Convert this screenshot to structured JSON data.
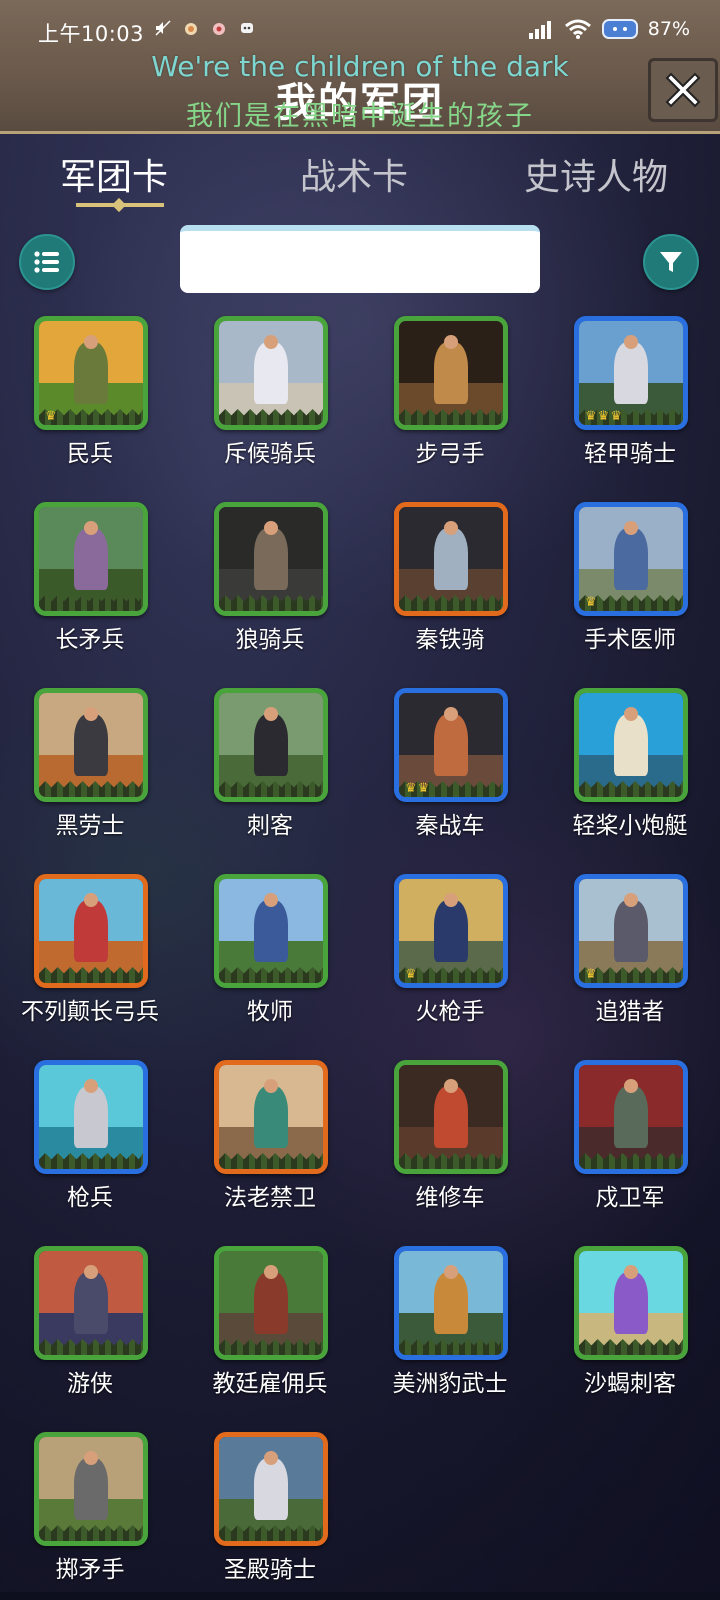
{
  "status_bar": {
    "time": "上午10:03",
    "battery": "87%"
  },
  "header": {
    "title": "我的军团",
    "lyric_en": "We're the children of the dark",
    "lyric_zh": "我们是在黑暗中诞生的孩子"
  },
  "tabs": [
    {
      "label": "军团卡",
      "active": true
    },
    {
      "label": "战术卡",
      "active": false
    },
    {
      "label": "史诗人物",
      "active": false
    }
  ],
  "search": {
    "value": "",
    "placeholder": ""
  },
  "icons": {
    "list": "list-icon",
    "filter": "filter-icon",
    "close": "close-icon"
  },
  "colors": {
    "rarity_green": "#49a53b",
    "rarity_blue": "#2a6fe0",
    "rarity_orange": "#e26a1c",
    "accent_teal": "#1f7a78"
  },
  "cards": [
    {
      "name": "民兵",
      "rarity": "green",
      "sky": "#e2a63a",
      "ground": "#5a8a2a",
      "fig": "#6a7a3a",
      "crowns": 1
    },
    {
      "name": "斥候骑兵",
      "rarity": "green",
      "sky": "#a9b8c8",
      "ground": "#c9c3b6",
      "fig": "#e8e8f0",
      "crowns": 0
    },
    {
      "name": "步弓手",
      "rarity": "green",
      "sky": "#2a2018",
      "ground": "#6a4a2a",
      "fig": "#c08a4a",
      "crowns": 0
    },
    {
      "name": "轻甲骑士",
      "rarity": "blue",
      "sky": "#6aa0d0",
      "ground": "#3a5a3a",
      "fig": "#d8d8e0",
      "crowns": 3
    },
    {
      "name": "长矛兵",
      "rarity": "green",
      "sky": "#5a8a5a",
      "ground": "#3a5a2a",
      "fig": "#8a6a9a",
      "crowns": 0
    },
    {
      "name": "狼骑兵",
      "rarity": "green",
      "sky": "#2a2a28",
      "ground": "#3a3a38",
      "fig": "#7a6a5a",
      "crowns": 0
    },
    {
      "name": "秦铁骑",
      "rarity": "orange",
      "sky": "#2a2a30",
      "ground": "#5a4030",
      "fig": "#a0b0c0",
      "crowns": 0
    },
    {
      "name": "手术医师",
      "rarity": "blue",
      "sky": "#9ab0c8",
      "ground": "#7a8a6a",
      "fig": "#4a6aa0",
      "crowns": 1
    },
    {
      "name": "黑劳士",
      "rarity": "green",
      "sky": "#c8a880",
      "ground": "#b86a30",
      "fig": "#3a3a40",
      "crowns": 0
    },
    {
      "name": "刺客",
      "rarity": "green",
      "sky": "#7a9a70",
      "ground": "#4a6a3a",
      "fig": "#2a2a30",
      "crowns": 0
    },
    {
      "name": "秦战车",
      "rarity": "blue",
      "sky": "#2a2a30",
      "ground": "#6a4a3a",
      "fig": "#c06a40",
      "crowns": 2
    },
    {
      "name": "轻桨小炮艇",
      "rarity": "green",
      "sky": "#2aa0d8",
      "ground": "#2a6a8a",
      "fig": "#e8e0c8",
      "crowns": 0
    },
    {
      "name": "不列颠长弓兵",
      "rarity": "orange",
      "sky": "#6ab8d8",
      "ground": "#c06a30",
      "fig": "#c03a3a",
      "crowns": 0
    },
    {
      "name": "牧师",
      "rarity": "green",
      "sky": "#8ab8e0",
      "ground": "#4a7a3a",
      "fig": "#3a5a9a",
      "crowns": 0
    },
    {
      "name": "火枪手",
      "rarity": "blue",
      "sky": "#d0b060",
      "ground": "#5a6a4a",
      "fig": "#2a3a6a",
      "crowns": 1
    },
    {
      "name": "追猎者",
      "rarity": "blue",
      "sky": "#a8c0d0",
      "ground": "#8a7a5a",
      "fig": "#5a5a6a",
      "crowns": 1
    },
    {
      "name": "枪兵",
      "rarity": "blue",
      "sky": "#5ac8d8",
      "ground": "#2a8aa0",
      "fig": "#c8c8d0",
      "crowns": 0
    },
    {
      "name": "法老禁卫",
      "rarity": "orange",
      "sky": "#d8b890",
      "ground": "#8a6a4a",
      "fig": "#3a8a7a",
      "crowns": 0
    },
    {
      "name": "维修车",
      "rarity": "green",
      "sky": "#3a2a22",
      "ground": "#5a3a2a",
      "fig": "#c04a30",
      "crowns": 0
    },
    {
      "name": "戍卫军",
      "rarity": "blue",
      "sky": "#8a2a2a",
      "ground": "#4a2a2a",
      "fig": "#5a6a5a",
      "crowns": 0
    },
    {
      "name": "游侠",
      "rarity": "green",
      "sky": "#c05a40",
      "ground": "#3a3a60",
      "fig": "#4a4a6a",
      "crowns": 0
    },
    {
      "name": "教廷雇佣兵",
      "rarity": "green",
      "sky": "#4a7a3a",
      "ground": "#5a4a3a",
      "fig": "#8a3a2a",
      "crowns": 0
    },
    {
      "name": "美洲豹武士",
      "rarity": "blue",
      "sky": "#7ab8d8",
      "ground": "#3a5a3a",
      "fig": "#c88a3a",
      "crowns": 0
    },
    {
      "name": "沙蝎刺客",
      "rarity": "green",
      "sky": "#6ad8e0",
      "ground": "#c8b880",
      "fig": "#8a5ac8",
      "crowns": 0
    },
    {
      "name": "掷矛手",
      "rarity": "green",
      "sky": "#b8a078",
      "ground": "#5a7a3a",
      "fig": "#6a6a6a",
      "crowns": 0
    },
    {
      "name": "圣殿骑士",
      "rarity": "orange",
      "sky": "#5a7a9a",
      "ground": "#4a6a3a",
      "fig": "#d8d8e0",
      "crowns": 0
    }
  ]
}
